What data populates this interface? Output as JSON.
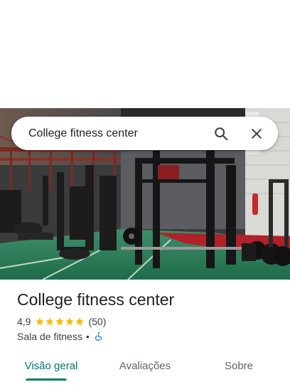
{
  "search": {
    "query": "College fitness center",
    "icons": [
      "search-icon",
      "close-icon"
    ]
  },
  "place": {
    "name": "College fitness center",
    "rating": "4,9",
    "star_count": 5,
    "reviews": "(50)",
    "category": "Sala de fitness",
    "separator": "•",
    "accessibility_icon": "wheelchair-icon"
  },
  "tabs": [
    {
      "label": "Visão geral",
      "active": true
    },
    {
      "label": "Avaliações",
      "active": false
    },
    {
      "label": "Sobre",
      "active": false
    }
  ],
  "colors": {
    "accent": "#00796b",
    "star": "#fbbc04",
    "accessibility": "#1a73e8"
  }
}
